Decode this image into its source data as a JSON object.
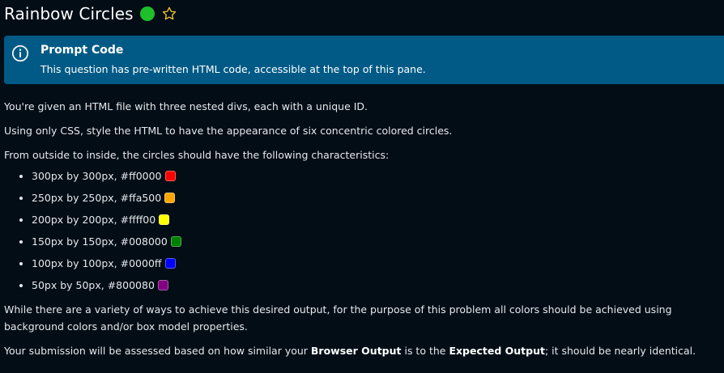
{
  "header": {
    "title": "Rainbow Circles",
    "status_color": "#1fbf2a",
    "star_icon": "star-outline-icon"
  },
  "callout": {
    "title": "Prompt Code",
    "text": "This question has pre-written HTML code, accessible at the top of this pane.",
    "icon": "info-circle-icon",
    "background": "#015a85"
  },
  "content": {
    "para1": "You're given an HTML file with three nested divs, each with a unique ID.",
    "para2": "Using only CSS, style the HTML to have the appearance of six concentric colored circles.",
    "para3": "From outside to inside, the circles should have the following characteristics:",
    "circles": [
      {
        "label": "300px by 300px, #ff0000",
        "color": "#ff0000"
      },
      {
        "label": "250px by 250px, #ffa500",
        "color": "#ffa500"
      },
      {
        "label": "200px by 200px, #ffff00",
        "color": "#ffff00"
      },
      {
        "label": "150px by 150px, #008000",
        "color": "#008000"
      },
      {
        "label": "100px by 100px, #0000ff",
        "color": "#0000ff"
      },
      {
        "label": "50px by 50px, #800080",
        "color": "#800080"
      }
    ],
    "para4": "While there are a variety of ways to achieve this desired output, for the purpose of this problem all colors should be achieved using background colors and/or box model properties.",
    "para5_prefix": "Your submission will be assessed based on how similar your ",
    "para5_bold1": "Browser Output",
    "para5_middle": " is to the ",
    "para5_bold2": "Expected Output",
    "para5_suffix": "; it should be nearly identical."
  }
}
